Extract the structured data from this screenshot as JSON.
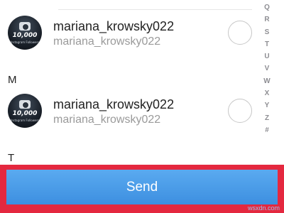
{
  "contacts": [
    {
      "username": "mariana_krowsky022",
      "fullname": "mariana_krowsky022",
      "avatar": {
        "icon": "camera-icon",
        "count_text": "10,000",
        "sub_text": "Instagram Followers"
      },
      "selected": false
    },
    {
      "username": "mariana_krowsky022",
      "fullname": "mariana_krowsky022",
      "avatar": {
        "icon": "camera-icon",
        "count_text": "10,000",
        "sub_text": "Instagram Followers"
      },
      "selected": false
    }
  ],
  "sections": {
    "m": "M",
    "t": "T"
  },
  "alphabet_index": [
    "Q",
    "R",
    "S",
    "T",
    "U",
    "V",
    "W",
    "X",
    "Y",
    "Z",
    "#"
  ],
  "send_label": "Send",
  "watermark": "wsxdn.com",
  "colors": {
    "send_button": "#4a9eea",
    "highlight_frame": "#e4283f",
    "selection_circle_border": "#c7c7c7",
    "secondary_text": "#9a9a9a"
  }
}
